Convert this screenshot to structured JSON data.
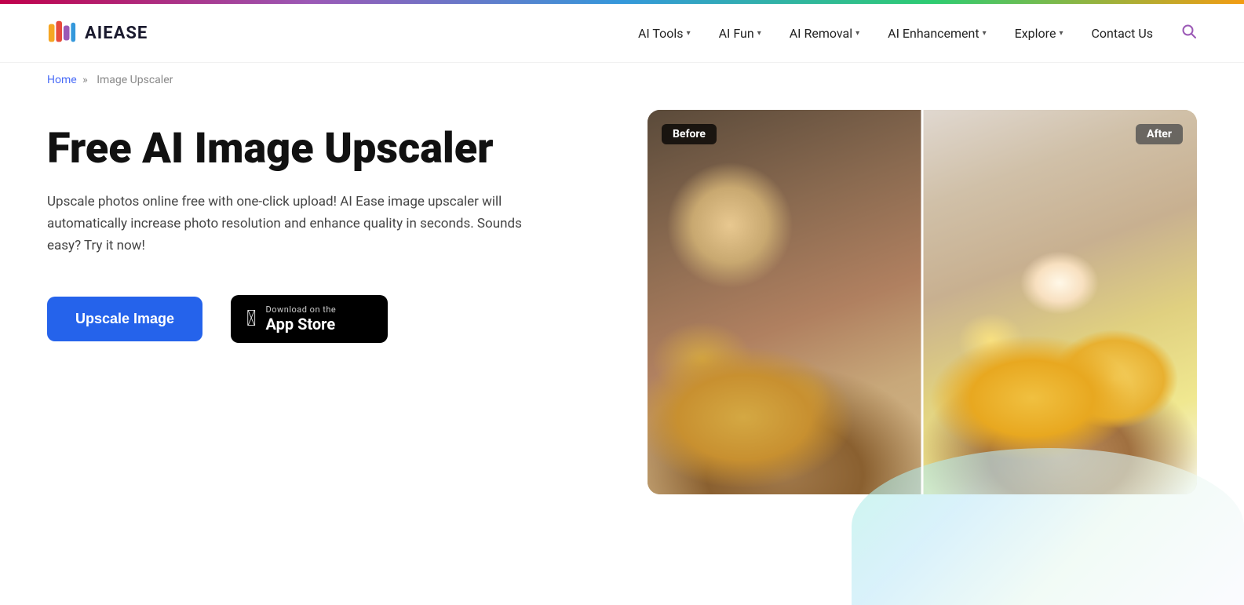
{
  "topbar": {},
  "header": {
    "logo_text": "AIEASE",
    "nav": [
      {
        "label": "AI Tools",
        "has_dropdown": true
      },
      {
        "label": "AI Fun",
        "has_dropdown": true
      },
      {
        "label": "AI Removal",
        "has_dropdown": true
      },
      {
        "label": "AI Enhancement",
        "has_dropdown": true
      },
      {
        "label": "Explore",
        "has_dropdown": true
      }
    ],
    "contact_us": "Contact Us"
  },
  "breadcrumb": {
    "home": "Home",
    "separator": "»",
    "current": "Image Upscaler"
  },
  "hero": {
    "title": "Free AI Image Upscaler",
    "description": "Upscale photos online free with one-click upload! AI Ease image upscaler will automatically increase photo resolution and enhance quality in seconds. Sounds easy? Try it now!",
    "upscale_button": "Upscale Image",
    "app_store": {
      "small_text": "Download on the",
      "large_text": "App Store"
    },
    "before_label": "Before",
    "after_label": "After"
  }
}
